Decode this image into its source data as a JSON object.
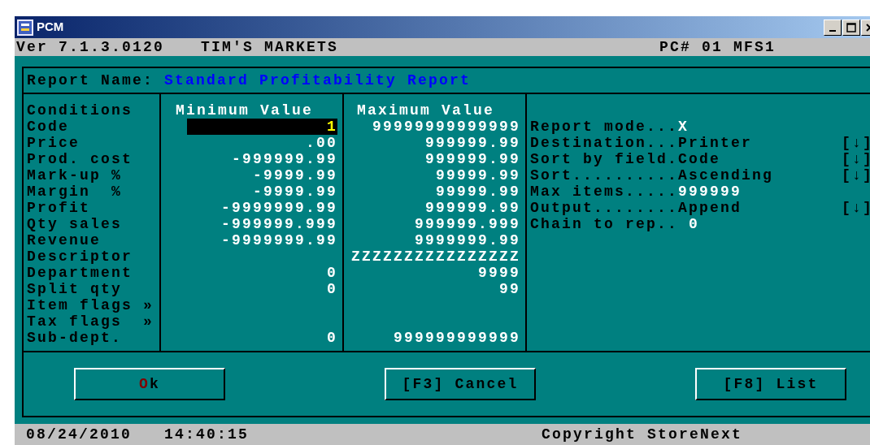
{
  "window": {
    "title": "PCM"
  },
  "header": {
    "version": "Ver 7.1.3.0120",
    "store": "TIM'S MARKETS",
    "station": "PC# 01 MFS1"
  },
  "report": {
    "label": "Report Name:",
    "name": "Standard Profitability Report"
  },
  "columns": [
    "Conditions",
    "Minimum Value",
    "Maximum Value"
  ],
  "conditions": [
    {
      "name": "Code",
      "min": "1",
      "max": "99999999999999",
      "focused": true
    },
    {
      "name": "Price",
      "min": ".00",
      "max": "999999.99",
      "focused": false
    },
    {
      "name": "Prod. cost",
      "min": "-999999.99",
      "max": "999999.99",
      "focused": false
    },
    {
      "name": "Mark-up %",
      "min": "-9999.99",
      "max": "99999.99",
      "focused": false
    },
    {
      "name": "Margin  %",
      "min": "-9999.99",
      "max": "99999.99",
      "focused": false
    },
    {
      "name": "Profit",
      "min": "-9999999.99",
      "max": "999999.99",
      "focused": false
    },
    {
      "name": "Qty sales",
      "min": "-999999.999",
      "max": "999999.999",
      "focused": false
    },
    {
      "name": "Revenue",
      "min": "-9999999.99",
      "max": "9999999.99",
      "focused": false
    },
    {
      "name": "Descriptor",
      "max": "ZZZZZZZZZZZZZZZZ"
    },
    {
      "name": "Department",
      "min": "0",
      "max": "9999",
      "focused": false
    },
    {
      "name": "Split qty",
      "min": "0",
      "max": "99",
      "focused": false
    },
    {
      "name": "Item flags »"
    },
    {
      "name": "Tax flags  »"
    },
    {
      "name": "Sub-dept.",
      "min": "0",
      "max": "999999999999",
      "focused": false
    }
  ],
  "options": [
    {
      "label": "Report mode...",
      "value": "X",
      "kind": "text"
    },
    {
      "label": "Destination...",
      "value": "Printer",
      "kind": "dropdown",
      "toggle": "[↓]"
    },
    {
      "label": "Sort by field.",
      "value": "Code",
      "kind": "dropdown",
      "toggle": "[↓]"
    },
    {
      "label": "Sort..........",
      "value": "Ascending",
      "kind": "dropdown",
      "toggle": "[↓]"
    },
    {
      "label": "Max items.....",
      "value": "999999",
      "kind": "text"
    },
    {
      "label": "Output........",
      "value": "Append",
      "kind": "dropdown",
      "toggle": "[↓]"
    },
    {
      "label": "Chain to rep.. ",
      "value": "0",
      "kind": "text"
    }
  ],
  "buttons": [
    {
      "hotkey": "O",
      "label": "k"
    },
    {
      "label": "[F3] Cancel"
    },
    {
      "label": "[F8] List"
    }
  ],
  "status_bar": {
    "date": "08/24/2010",
    "time": "14:40:15",
    "copyright": "Copyright StoreNext"
  }
}
